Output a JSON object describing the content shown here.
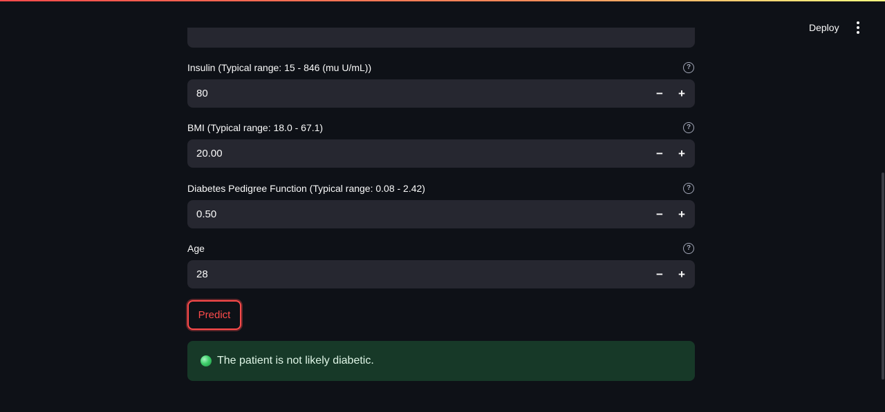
{
  "header": {
    "deploy_label": "Deploy",
    "menu_icon": "kebab-menu-icon"
  },
  "fields": [
    {
      "label": "Insulin (Typical range: 15 - 846 (mu U/mL))",
      "value": "80"
    },
    {
      "label": "BMI (Typical range: 18.0 - 67.1)",
      "value": "20.00"
    },
    {
      "label": "Diabetes Pedigree Function (Typical range: 0.08 - 2.42)",
      "value": "0.50"
    },
    {
      "label": "Age",
      "value": "28"
    }
  ],
  "stepper": {
    "minus": "−",
    "plus": "+"
  },
  "help_icon_glyph": "?",
  "predict_label": "Predict",
  "result": {
    "text": "The patient is not likely diabetic.",
    "icon": "green-circle-icon"
  },
  "colors": {
    "accent": "#ff4b4b",
    "background": "#0e1117",
    "input_bg": "#262730",
    "success_bg": "#173928"
  }
}
